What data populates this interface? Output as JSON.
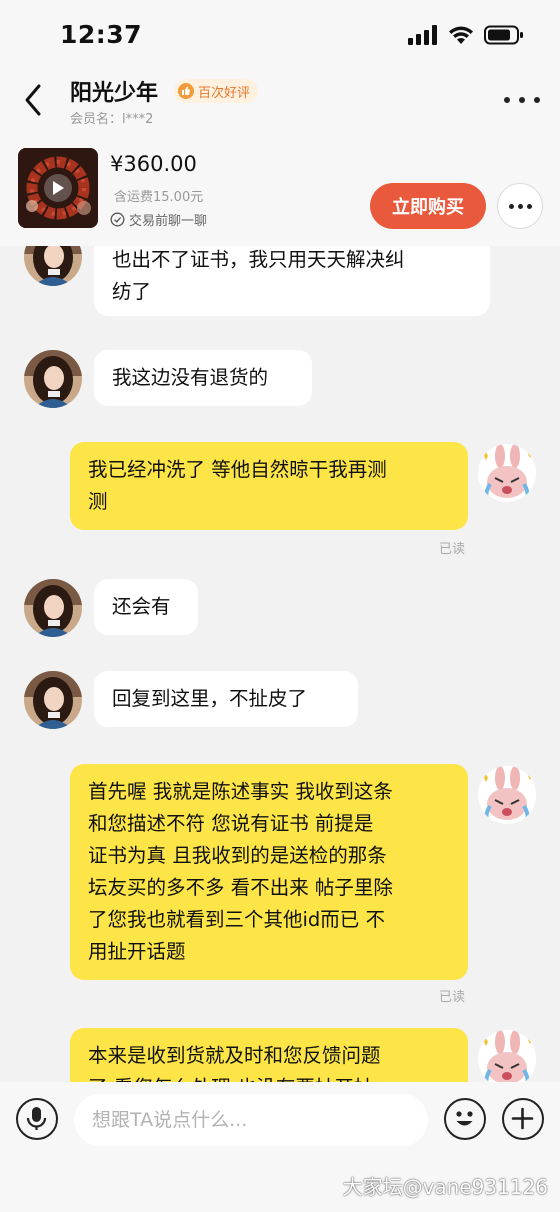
{
  "status_bar": {
    "time": "12:37"
  },
  "header": {
    "name": "阳光少年",
    "badge": "百次好评",
    "member_label": "会员名：l***2"
  },
  "product": {
    "price": "¥360.00",
    "shipping": "含运费15.00元",
    "chat_hint": "交易前聊一聊",
    "buy_label": "立即购买"
  },
  "messages": [
    {
      "side": "left",
      "text_lines": [
        "也出不了证书，我只用天天解决纠",
        "纺了"
      ]
    },
    {
      "side": "left",
      "text_lines": [
        "我这边没有退货的"
      ]
    },
    {
      "side": "right",
      "text_lines": [
        "我已经冲洗了 等他自然晾干我再测",
        "测"
      ],
      "status": "已读"
    },
    {
      "side": "left",
      "text_lines": [
        "还会有"
      ]
    },
    {
      "side": "left",
      "text_lines": [
        "回复到这里，不扯皮了"
      ]
    },
    {
      "side": "right",
      "text_lines": [
        "首先喔 我就是陈述事实 我收到这条",
        "和您描述不符 您说有证书  前提是",
        "证书为真 且我收到的是送检的那条",
        "坛友买的多不多 看不出来 帖子里除",
        "了您我也就看到三个其他id而已 不",
        "用扯开话题"
      ],
      "status": "已读"
    },
    {
      "side": "right",
      "text_lines": [
        "本来是收到货就及时和您反馈问题",
        "了 看您怎么处理 也没有要扯开扯"
      ]
    }
  ],
  "input": {
    "placeholder": "想跟TA说点什么..."
  },
  "watermark": "大家坛@vane931126",
  "colors": {
    "accent": "#e95a3d",
    "my_bubble": "#fde547",
    "their_bubble": "#ffffff",
    "badge_text": "#e7772c"
  }
}
